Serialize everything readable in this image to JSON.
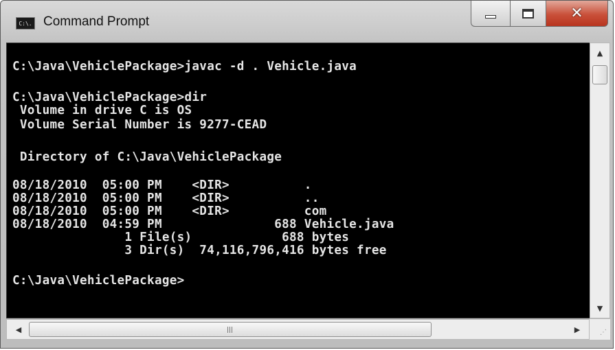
{
  "window": {
    "title": "Command Prompt",
    "icon_label": "C:\\.",
    "icons": {
      "app": "command-prompt-icon",
      "minimize": "minimize-icon",
      "maximize": "maximize-icon",
      "close": "close-icon"
    }
  },
  "console": {
    "background": "#000000",
    "foreground": "#e6e6e6",
    "lines": [
      "C:\\Java\\VehiclePackage>javac -d . Vehicle.java",
      "C:\\Java\\VehiclePackage>dir",
      " Volume in drive C is OS",
      " Volume Serial Number is 9277-CEAD",
      " Directory of C:\\Java\\VehiclePackage",
      "08/18/2010  05:00 PM    <DIR>          .",
      "08/18/2010  05:00 PM    <DIR>          ..",
      "08/18/2010  05:00 PM    <DIR>          com",
      "08/18/2010  04:59 PM               688 Vehicle.java",
      "               1 File(s)            688 bytes",
      "               3 Dir(s)  74,116,796,416 bytes free",
      "C:\\Java\\VehiclePackage>"
    ]
  },
  "scrollbars": {
    "up_icon": "scroll-up-arrow-icon",
    "down_icon": "scroll-down-arrow-icon",
    "left_icon": "scroll-left-arrow-icon",
    "right_icon": "scroll-right-arrow-icon",
    "grip_icon": "size-grip-icon"
  }
}
